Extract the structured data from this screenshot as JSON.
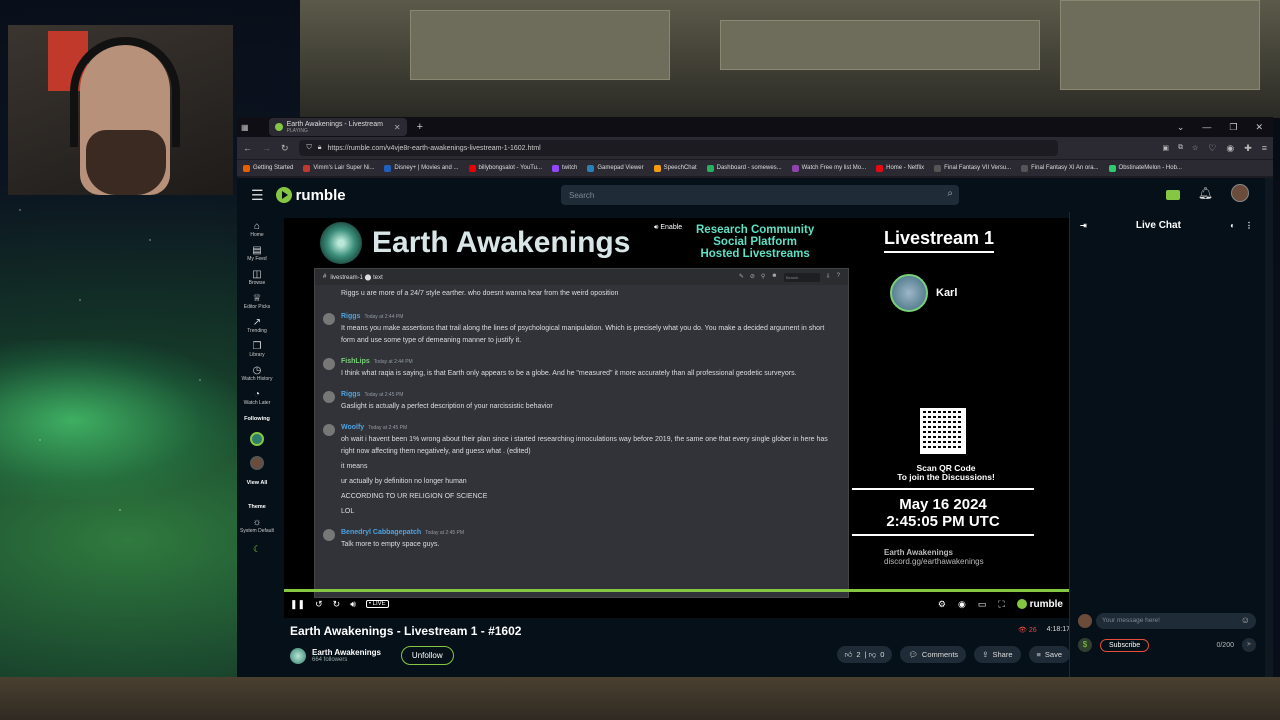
{
  "browser": {
    "tab_title": "Earth Awakenings - Livestream",
    "tab_sub": "PLAYING",
    "new_tab": "+",
    "url": "https://rumble.com/v4vje8r-earth-awakenings-livestream-1-1602.html",
    "bookmarks": [
      {
        "label": "Getting Started",
        "color": "#e66000"
      },
      {
        "label": "Vimm's Lair Super Ni...",
        "color": "#c0392b"
      },
      {
        "label": "Disney+ | Movies and ...",
        "color": "#1f5fbf"
      },
      {
        "label": "billybongsalot - YouTu...",
        "color": "#e00"
      },
      {
        "label": "twitch",
        "color": "#9146ff"
      },
      {
        "label": "Gamepad Viewer",
        "color": "#2980b9"
      },
      {
        "label": "SpeechChat",
        "color": "#f39c12"
      },
      {
        "label": "Dashboard - somewes...",
        "color": "#27ae60"
      },
      {
        "label": "Watch Free my list Mo...",
        "color": "#8e44ad"
      },
      {
        "label": "Home - Netflix",
        "color": "#e50914"
      },
      {
        "label": "Final Fantasy VII Versu...",
        "color": "#555"
      },
      {
        "label": "Final Fantasy XI An ora...",
        "color": "#555"
      },
      {
        "label": "ObstinateMelon - Hob...",
        "color": "#2ecc71"
      }
    ]
  },
  "header": {
    "search_placeholder": "Search"
  },
  "sidebar": {
    "items": [
      {
        "icon": "home-icon",
        "glyph": "⌂",
        "label": "Home"
      },
      {
        "icon": "feed-icon",
        "glyph": "▤",
        "label": "My Feed"
      },
      {
        "icon": "browse-icon",
        "glyph": "◫",
        "label": "Browse"
      },
      {
        "icon": "editor-picks-icon",
        "glyph": "♕",
        "label": "Editor Picks"
      },
      {
        "icon": "trending-icon",
        "glyph": "↗",
        "label": "Trending"
      },
      {
        "icon": "library-icon",
        "glyph": "❐",
        "label": "Library"
      },
      {
        "icon": "watch-history-icon",
        "glyph": "◷",
        "label": "Watch History"
      },
      {
        "icon": "watch-later-icon",
        "glyph": "◔",
        "label": "Watch Later"
      }
    ],
    "following": "Following",
    "view_all": "View All",
    "theme": "Theme",
    "system_default": "System Default"
  },
  "stream": {
    "brand": "Earth Awakenings",
    "enable": "Enable",
    "tagline": [
      "Research Community",
      "Social Platform",
      "Hosted Livestreams"
    ],
    "livestream_title": "Livestream 1",
    "host_name": "Karl",
    "qr_text": "Scan QR Code\nTo join the Discussions!",
    "date": "May 16 2024",
    "time": "2:45:05 PM UTC",
    "discord_name": "Earth Awakenings",
    "discord_url": "discord.gg/earthawakenings"
  },
  "discord": {
    "channel": "livestream-1 ⬤ text",
    "search": "Search",
    "first_line": "Riggs u are more of a 24/7 style earther. who doesnt wanna hear from the weird oposition",
    "messages": [
      {
        "name": "Riggs",
        "color": "#4fa3e0",
        "time": "Today at 2:44 PM",
        "lines": [
          "It means you make assertions that trail along the lines of psychological manipulation. Which is precisely what you do. You make a decided argument in short form and use some type of demeaning manner to justify it."
        ]
      },
      {
        "name": "FishLips",
        "color": "#7ad07a",
        "time": "Today at 2:44 PM",
        "lines": [
          "I think what raqia is saying, is that Earth only appears to be a globe. And he \"measured\" it more accurately than all professional geodetic surveyors."
        ]
      },
      {
        "name": "Riggs",
        "color": "#4fa3e0",
        "time": "Today at 2:45 PM",
        "lines": [
          "Gaslight is actually a perfect description of your narcissistic behavior"
        ]
      },
      {
        "name": "Woolfy",
        "color": "#4fa3e0",
        "time": "Today at 2:45 PM",
        "lines": [
          "oh wait i havent been 1% wrong about their plan since i started researching innoculations way before 2019, the same one that every single glober in here has right now affecting them negatively, and guess what . (edited)",
          "it means",
          "ur actually by definition no longer human",
          "ACCORDING TO UR RELIGION OF SCIENCE",
          "LOL"
        ]
      },
      {
        "name": "Benedryl Cabbagepatch",
        "color": "#4fa3e0",
        "time": "Today at 2:45 PM",
        "lines": [
          "Talk more to empty space guys."
        ]
      }
    ]
  },
  "controls": {
    "live": "• LIVE"
  },
  "video": {
    "title": "Earth Awakenings - Livestream 1 - #1602",
    "viewers": "26",
    "duration": "4:18:17",
    "channel": "Earth Awakenings",
    "followers": "664 followers",
    "unfollow": "Unfollow",
    "likes": "2",
    "dislikes": "0",
    "comments": "Comments",
    "share": "Share",
    "save": "Save"
  },
  "chat": {
    "title": "Live Chat",
    "placeholder": "Your message here!",
    "subscribe": "Subscribe",
    "counter": "0/200"
  }
}
